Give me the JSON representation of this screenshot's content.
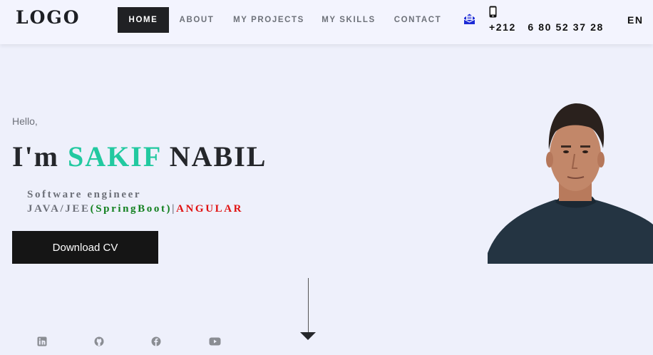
{
  "header": {
    "logo": "LOGO",
    "nav": [
      {
        "label": "HOME",
        "active": true
      },
      {
        "label": "ABOUT",
        "active": false
      },
      {
        "label": "MY PROJECTS",
        "active": false
      },
      {
        "label": "MY SKILLS",
        "active": false
      },
      {
        "label": "CONTACT",
        "active": false
      }
    ],
    "mail_icon": "envelope-open-icon",
    "phone_icon": "mobile-phone-icon",
    "phone": "+212   6 80 52 37 28",
    "language": "EN"
  },
  "hero": {
    "greeting": "Hello,",
    "im": "I'm",
    "first_name": "SAKIF",
    "last_name": "NABIL",
    "role": "Software engineer",
    "stack_main": "JAVA/JEE",
    "stack_framework": "(SpringBoot)",
    "stack_separator": "|",
    "stack_frontend": "ANGULAR",
    "download_label": "Download CV",
    "photo_icon": "profile-photo"
  },
  "social": [
    "linkedin-icon",
    "github-icon",
    "facebook-icon",
    "youtube-icon"
  ],
  "scroll_icon": "scroll-down-arrow-icon",
  "colors": {
    "accent": "#22c9a0",
    "framework_green": "#12801f",
    "frontend_red": "#e01010",
    "mail_blue": "#1c2bd6",
    "background": "#eef0fb"
  }
}
